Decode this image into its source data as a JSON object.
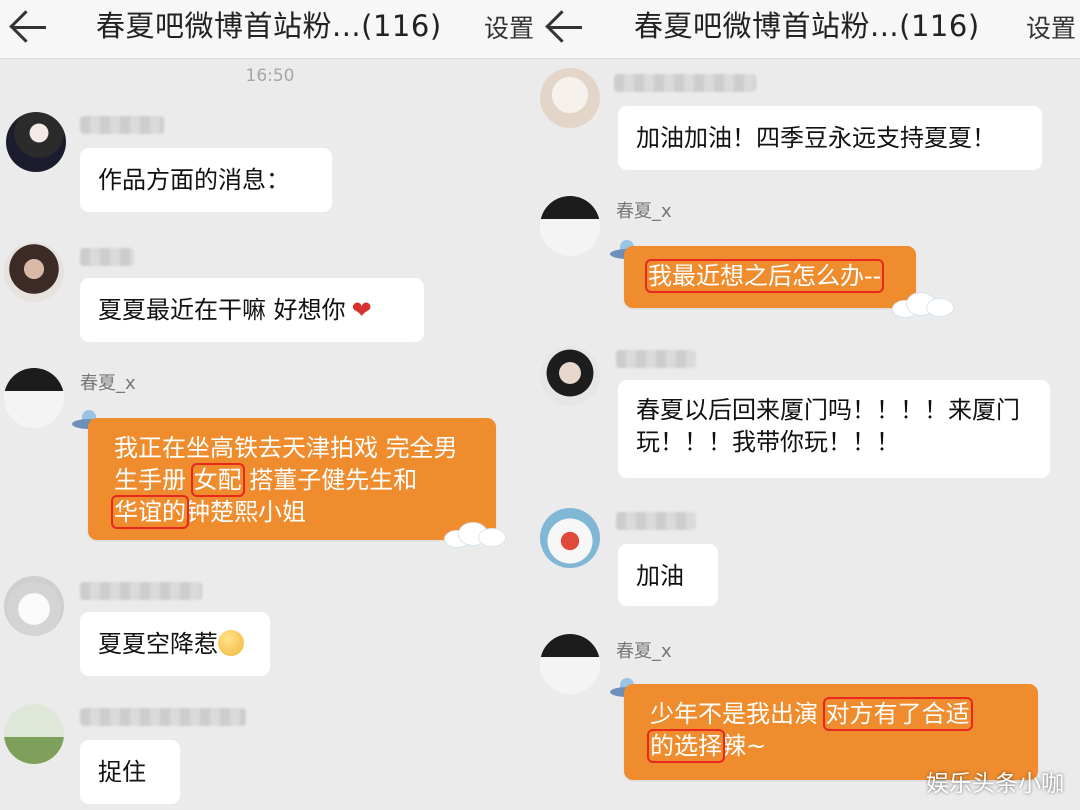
{
  "left": {
    "title": "春夏吧微博首站粉...(116)",
    "settings": "设置",
    "time": "16:50",
    "messages": [
      {
        "text": "作品方面的消息："
      },
      {
        "text": "夏夏最近在干嘛 好想你"
      },
      {
        "name": "春夏_x",
        "parts": [
          "我正在坐高铁去天津拍戏 完全男生手册 ",
          "女配",
          " 搭董子健先生和",
          "华谊的",
          "钟楚熙小姐"
        ]
      },
      {
        "text": "夏夏空降惹"
      },
      {
        "text": "捉住"
      }
    ]
  },
  "right": {
    "title": "春夏吧微博首站粉...(116)",
    "settings": "设置",
    "messages": [
      {
        "text": "加油加油！四季豆永远支持夏夏！"
      },
      {
        "name": "春夏_x",
        "text": "我最近想之后怎么办--"
      },
      {
        "text": "春夏以后回来厦门吗！！！！来厦门玩！！！我带你玩！！！"
      },
      {
        "text": "加油"
      },
      {
        "name": "春夏_x",
        "parts": [
          "少年不是我出演 ",
          "对方有了合适",
          "的选择",
          "辣~"
        ]
      }
    ]
  },
  "watermark": "娱乐头条小咖",
  "colors": {
    "orange": "#ef8c2e",
    "highlight": "#e8281f",
    "background": "#ebebeb"
  }
}
